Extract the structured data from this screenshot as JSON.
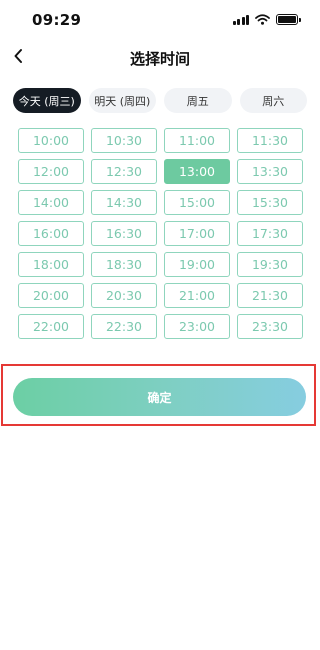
{
  "status_bar": {
    "time": "09:29",
    "signal_icon": "cellular-signal-icon",
    "wifi_icon": "wifi-icon",
    "battery_icon": "battery-icon"
  },
  "nav": {
    "back_icon": "chevron-left-icon",
    "title": "选择时间"
  },
  "day_tabs": [
    {
      "label": "今天 (周三)",
      "active": true
    },
    {
      "label": "明天 (周四)",
      "active": false
    },
    {
      "label": "周五",
      "active": false
    },
    {
      "label": "周六",
      "active": false
    }
  ],
  "time_slots": [
    "10:00",
    "10:30",
    "11:00",
    "11:30",
    "12:00",
    "12:30",
    "13:00",
    "13:30",
    "14:00",
    "14:30",
    "15:00",
    "15:30",
    "16:00",
    "16:30",
    "17:00",
    "17:30",
    "18:00",
    "18:30",
    "19:00",
    "19:30",
    "20:00",
    "20:30",
    "21:00",
    "21:30",
    "22:00",
    "22:30",
    "23:00",
    "23:30"
  ],
  "selected_slot": "13:00",
  "confirm_label": "确定",
  "colors": {
    "accent": "#6dcaa0",
    "slot_border": "#8fd5bd",
    "active_tab": "#151c24",
    "highlight_frame": "#e53935"
  }
}
